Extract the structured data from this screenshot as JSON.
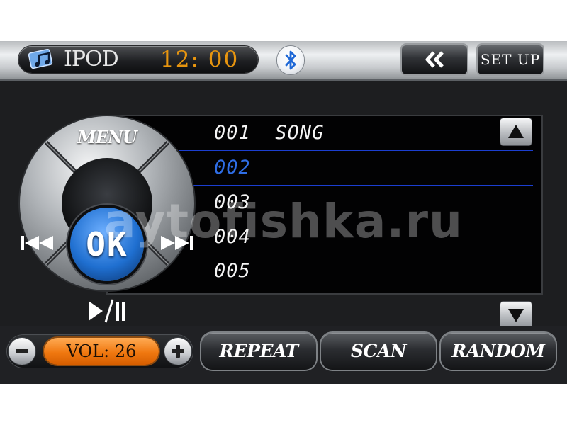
{
  "header": {
    "source_label": "IPOD",
    "clock": "12: 00",
    "setup_label": "SET UP",
    "icons": {
      "source": "music-note-icon",
      "bluetooth": "bluetooth-icon",
      "back": "double-chevron-left-icon"
    }
  },
  "controls": {
    "menu_label": "MENU",
    "ok_label": "OK",
    "prev_icon": "previous-track-icon",
    "next_icon": "next-track-icon",
    "play_pause_icon": "play-pause-icon"
  },
  "playlist": {
    "tracks": [
      {
        "number": "001",
        "title": "SONG"
      },
      {
        "number": "002",
        "title": ""
      },
      {
        "number": "003",
        "title": ""
      },
      {
        "number": "004",
        "title": ""
      },
      {
        "number": "005",
        "title": ""
      }
    ],
    "selected_index": 1,
    "scroll_up_icon": "arrow-up-icon",
    "scroll_down_icon": "arrow-down-icon"
  },
  "volume": {
    "label": "VOL: 26",
    "minus_icon": "minus-icon",
    "plus_icon": "plus-icon"
  },
  "buttons": {
    "repeat": "REPEAT",
    "scan": "SCAN",
    "random": "RANDOM"
  },
  "watermark": "aytofishka.ru",
  "colors": {
    "clock": "#e7950f",
    "selected_track": "#2f6ee6",
    "volume_display": "#f07810",
    "ok_center": "#1f6fd0",
    "row_separator": "#1b3ed0"
  }
}
